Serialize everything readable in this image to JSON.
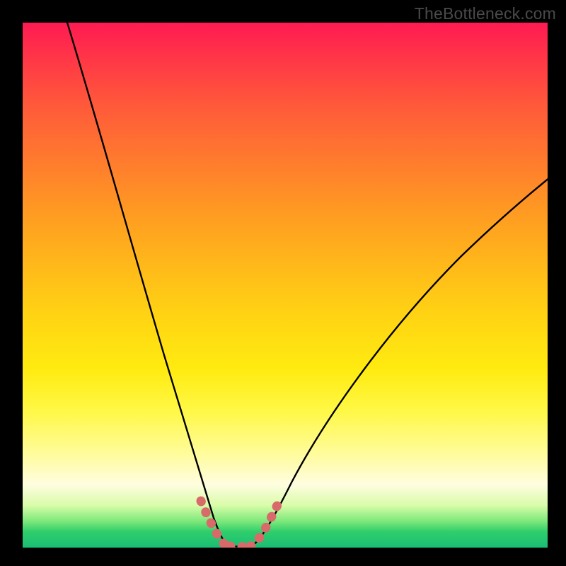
{
  "watermark": "TheBottleneck.com",
  "colors": {
    "background": "#000000",
    "gradient_top": "#ff1a52",
    "gradient_mid": "#ffe010",
    "gradient_bottom": "#1bbd74",
    "curve": "#000000",
    "highlight": "#d86a6a"
  },
  "chart_data": {
    "type": "line",
    "title": "",
    "xlabel": "",
    "ylabel": "",
    "xlim": [
      0,
      100
    ],
    "ylim": [
      0,
      100
    ],
    "series": [
      {
        "name": "left-curve",
        "x": [
          8,
          12,
          16,
          20,
          24,
          28,
          30,
          32,
          34,
          35.5,
          37
        ],
        "y": [
          100,
          82,
          66,
          51,
          37,
          24,
          18,
          12,
          6.5,
          3,
          0.5
        ]
      },
      {
        "name": "right-curve",
        "x": [
          44,
          46,
          48,
          52,
          58,
          66,
          76,
          88,
          100
        ],
        "y": [
          0.5,
          3.5,
          7,
          13,
          22,
          33,
          45,
          57,
          67
        ]
      },
      {
        "name": "bottom-flat",
        "x": [
          37,
          40,
          44
        ],
        "y": [
          0.5,
          0.2,
          0.5
        ]
      }
    ],
    "highlight_segments": [
      {
        "name": "left-bottom",
        "x": [
          32.5,
          34,
          35.5,
          37,
          38.5
        ],
        "y": [
          9,
          5.5,
          3,
          1.2,
          0.5
        ]
      },
      {
        "name": "bottom",
        "x": [
          38.5,
          40,
          42,
          43.5
        ],
        "y": [
          0.5,
          0.2,
          0.3,
          0.6
        ]
      },
      {
        "name": "right-bottom",
        "x": [
          43.5,
          45,
          46.5,
          48
        ],
        "y": [
          0.6,
          2.2,
          4.5,
          7.5
        ]
      }
    ],
    "gradient_meaning": "vertical value scale (red=high, green=low)"
  }
}
